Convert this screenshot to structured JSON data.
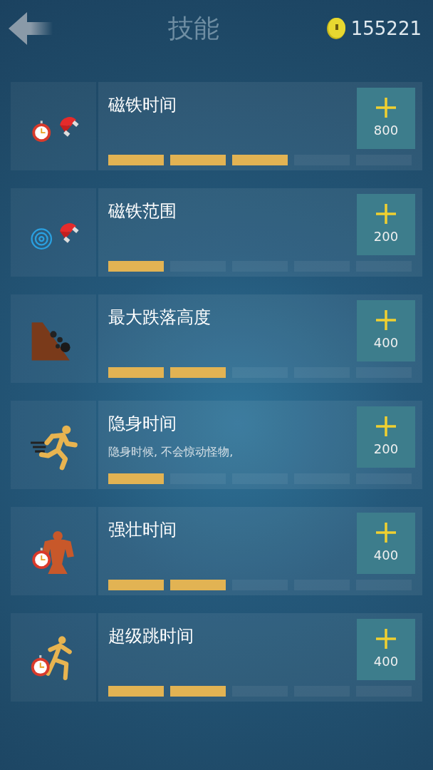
{
  "header": {
    "title": "技能",
    "coins": "155221"
  },
  "skills": [
    {
      "name": "磁铁时间",
      "price": "800",
      "segments": [
        {
          "filled": true
        },
        {
          "filled": true
        },
        {
          "filled": true
        },
        {
          "filled": false
        },
        {
          "filled": false
        }
      ]
    },
    {
      "name": "磁铁范围",
      "price": "200",
      "segments": [
        {
          "filled": true
        },
        {
          "filled": false
        },
        {
          "filled": false
        },
        {
          "filled": false
        },
        {
          "filled": false
        }
      ]
    },
    {
      "name": "最大跌落高度",
      "price": "400",
      "segments": [
        {
          "filled": true
        },
        {
          "filled": true
        },
        {
          "filled": false
        },
        {
          "filled": false
        },
        {
          "filled": false
        }
      ]
    },
    {
      "name": "隐身时间",
      "description": "隐身时候, 不会惊动怪物,",
      "price": "200",
      "segments": [
        {
          "filled": true
        },
        {
          "filled": false
        },
        {
          "filled": false
        },
        {
          "filled": false
        },
        {
          "filled": false
        }
      ]
    },
    {
      "name": "强壮时间",
      "price": "400",
      "segments": [
        {
          "filled": true
        },
        {
          "filled": true
        },
        {
          "filled": false
        },
        {
          "filled": false
        },
        {
          "filled": false
        }
      ]
    },
    {
      "name": "超级跳时间",
      "price": "400",
      "segments": [
        {
          "filled": true
        },
        {
          "filled": true
        },
        {
          "filled": false
        },
        {
          "filled": false
        },
        {
          "filled": false
        }
      ]
    }
  ]
}
